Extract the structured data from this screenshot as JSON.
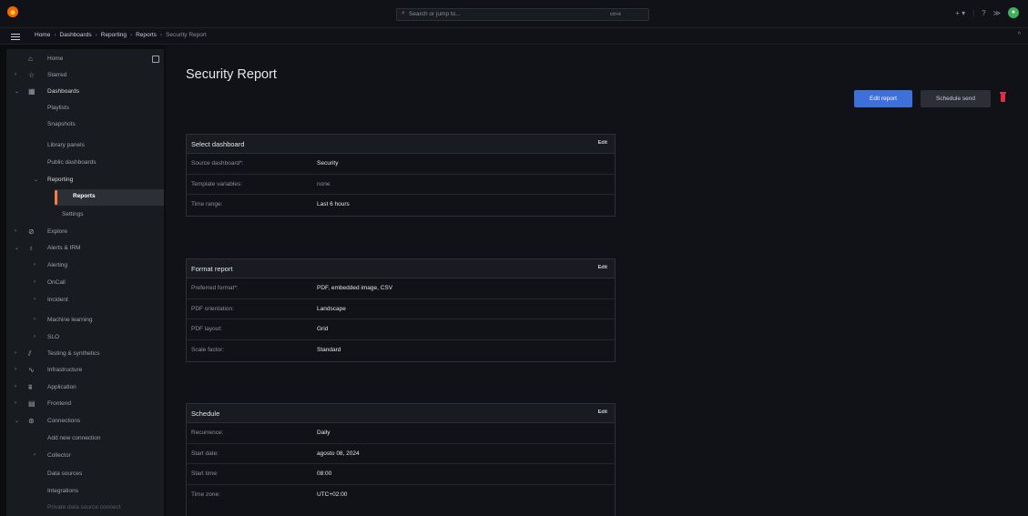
{
  "topbar": {
    "search_placeholder": "Search or jump to...",
    "search_shortcut": "ctrl+k",
    "plus_label": "+ ▾"
  },
  "breadcrumb": [
    "Home",
    "Dashboards",
    "Reporting",
    "Reports",
    "Security Report"
  ],
  "sidebar": {
    "items": [
      {
        "label": "Home"
      },
      {
        "label": "Starred"
      },
      {
        "label": "Dashboards"
      },
      {
        "label": "Playlists"
      },
      {
        "label": "Snapshots"
      },
      {
        "label": "Library panels"
      },
      {
        "label": "Public dashboards"
      },
      {
        "label": "Reporting"
      },
      {
        "label": "Reports"
      },
      {
        "label": "Settings"
      },
      {
        "label": "Explore"
      },
      {
        "label": "Alerts & IRM"
      },
      {
        "label": "Alerting"
      },
      {
        "label": "OnCall"
      },
      {
        "label": "Incident"
      },
      {
        "label": "Machine learning"
      },
      {
        "label": "SLO"
      },
      {
        "label": "Testing & synthetics"
      },
      {
        "label": "Infrastructure"
      },
      {
        "label": "Application"
      },
      {
        "label": "Frontend"
      },
      {
        "label": "Connections"
      },
      {
        "label": "Add new connection"
      },
      {
        "label": "Collector"
      },
      {
        "label": "Data sources"
      },
      {
        "label": "Integrations"
      },
      {
        "label": "Private data source connect"
      }
    ]
  },
  "page": {
    "title": "Security Report",
    "edit_report_label": "Edit report",
    "schedule_send_label": "Schedule send"
  },
  "cards": {
    "select_dashboard": {
      "title": "Select dashboard",
      "edit": "Edit",
      "rows": [
        {
          "k": "Source dashboard*:",
          "v": "Security"
        },
        {
          "k": "Template variables:",
          "v": "none"
        },
        {
          "k": "Time range:",
          "v": "Last 6 hours"
        }
      ]
    },
    "format_report": {
      "title": "Format report",
      "edit": "Edit",
      "rows": [
        {
          "k": "Preferred format*:",
          "v": "PDF, embedded image, CSV"
        },
        {
          "k": "PDF orientation:",
          "v": "Landscape"
        },
        {
          "k": "PDF layout:",
          "v": "Grid"
        },
        {
          "k": "Scale factor:",
          "v": "Standard"
        }
      ]
    },
    "schedule": {
      "title": "Schedule",
      "edit": "Edit",
      "rows": [
        {
          "k": "Recurrence:",
          "v": "Daily"
        },
        {
          "k": "Start date:",
          "v": "agosto 08, 2024"
        },
        {
          "k": "Start time:",
          "v": "08:00"
        },
        {
          "k": "Time zone:",
          "v": "UTC+02:00"
        }
      ]
    }
  },
  "colors": {
    "accent": "#3d71d9",
    "active_bar": "#ff7941",
    "danger": "#e02f44"
  }
}
